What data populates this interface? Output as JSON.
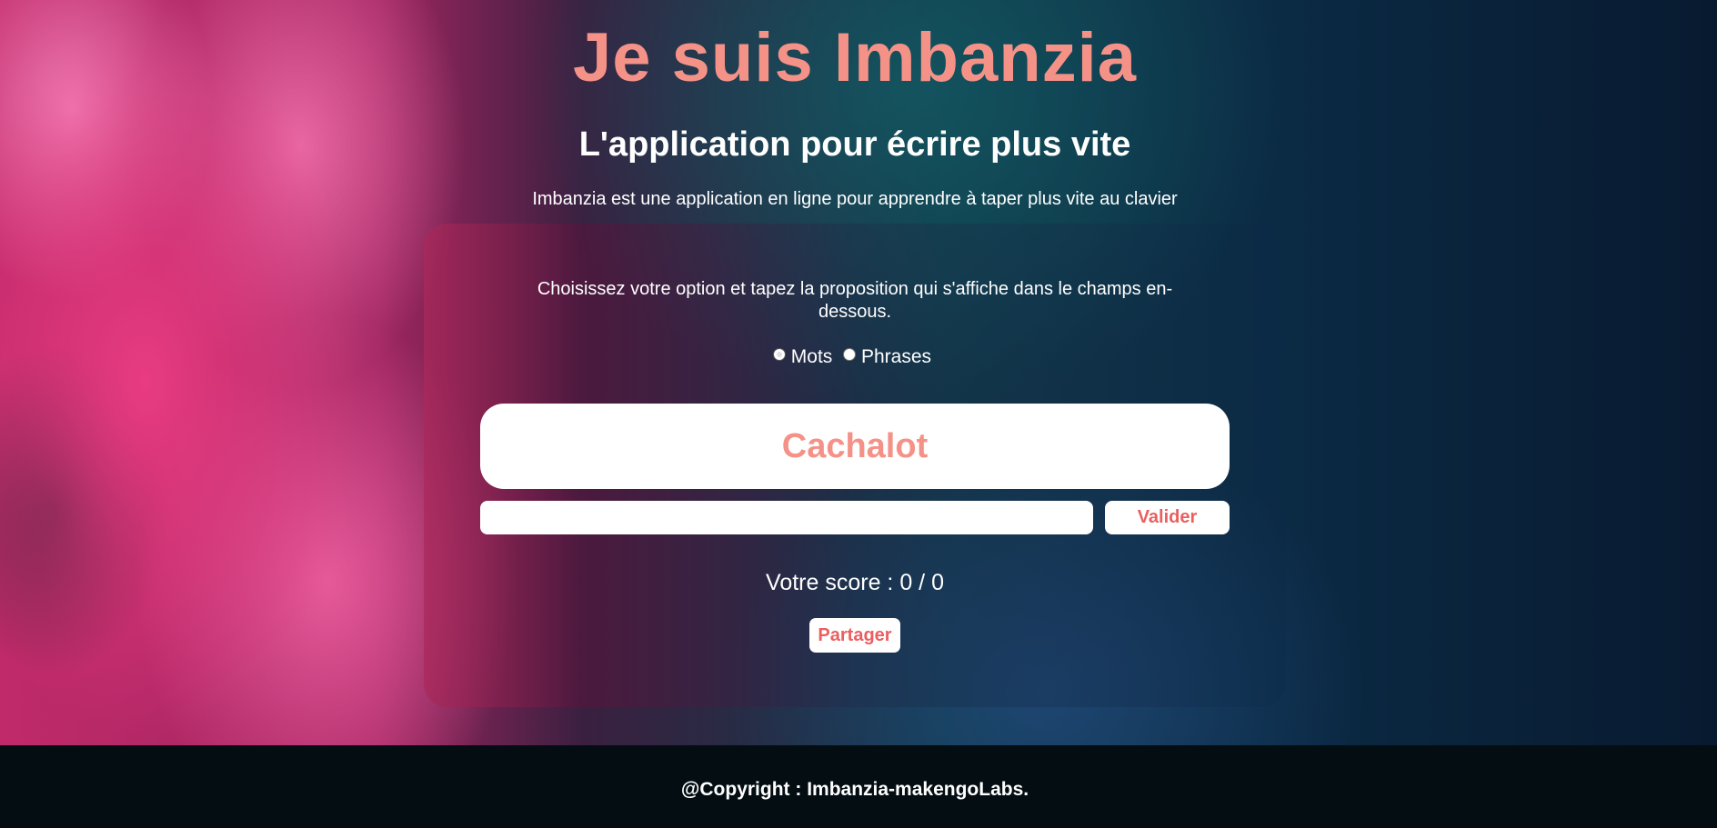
{
  "header": {
    "title": "Je suis Imbanzia",
    "subtitle": "L'application pour écrire plus vite",
    "description": "Imbanzia est une application en ligne pour apprendre à taper plus vite au clavier"
  },
  "game": {
    "instructions": "Choisissez votre option et tapez la proposition qui s'affiche dans le champs en-dessous.",
    "options": [
      {
        "label": "Mots",
        "checked": true
      },
      {
        "label": "Phrases",
        "checked": false
      }
    ],
    "current_word": "Cachalot",
    "input_value": "",
    "validate_label": "Valider",
    "score_text": "Votre score : 0 / 0",
    "share_label": "Partager"
  },
  "footer": {
    "copyright": "@Copyright : Imbanzia-makengoLabs."
  },
  "colors": {
    "accent": "#f59288",
    "button_text": "#ea5f5f",
    "footer_bg": "#030d12"
  }
}
